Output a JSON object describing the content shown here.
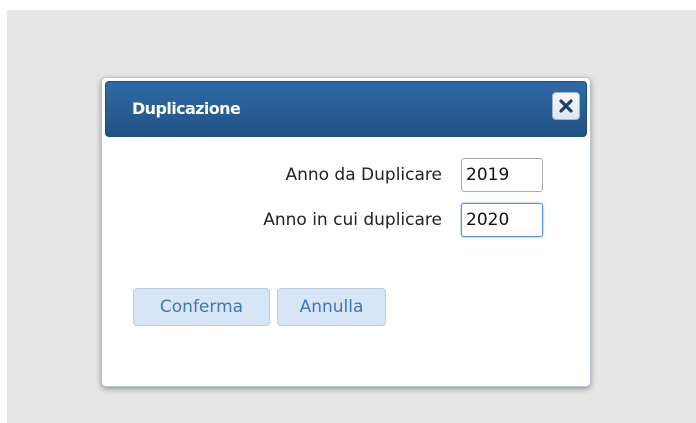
{
  "dialog": {
    "title": "Duplicazione",
    "close_icon": "close-icon",
    "fields": [
      {
        "label": "Anno da Duplicare",
        "value": "2019"
      },
      {
        "label": "Anno in cui duplicare",
        "value": "2020"
      }
    ],
    "buttons": {
      "confirm": "Conferma",
      "cancel": "Annulla"
    }
  },
  "colors": {
    "titlebar": "#2a5f98",
    "button_bg": "#d6e6f6",
    "button_text": "#3f77b2",
    "backdrop": "#e6e6e6"
  }
}
